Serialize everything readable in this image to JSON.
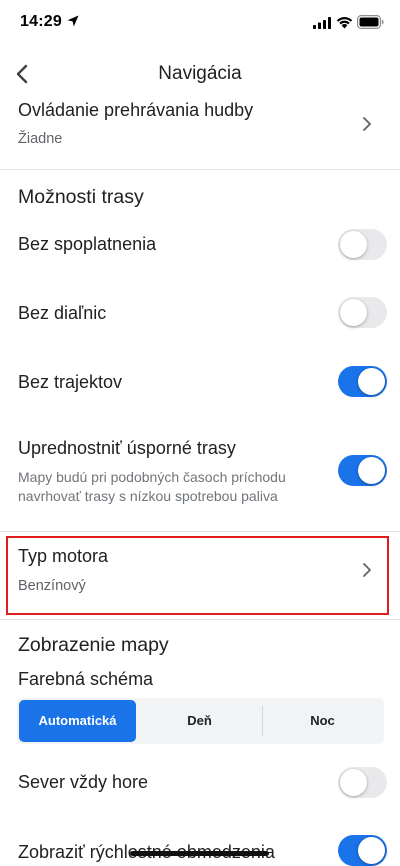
{
  "status_bar": {
    "time": "14:29"
  },
  "header": {
    "title": "Navigácia"
  },
  "music_control": {
    "title": "Ovládanie prehrávania hudby",
    "value": "Žiadne"
  },
  "route_options": {
    "section_title": "Možnosti trasy",
    "avoid_tolls": {
      "label": "Bez spoplatnenia",
      "checked": false
    },
    "avoid_highways": {
      "label": "Bez diaľnic",
      "checked": false
    },
    "avoid_ferries": {
      "label": "Bez trajektov",
      "checked": true
    },
    "eco_routes": {
      "label": "Uprednostniť úsporné trasy",
      "description_line1": "Mapy budú pri podobných časoch príchodu",
      "description_line2": "navrhovať trasy s nízkou spotrebou paliva",
      "checked": true
    }
  },
  "engine_type": {
    "title": "Typ motora",
    "value": "Benzínový"
  },
  "map_display": {
    "section_title": "Zobrazenie mapy",
    "color_scheme_label": "Farebná schéma",
    "color_scheme_options": [
      "Automatická",
      "Deň",
      "Noc"
    ],
    "color_scheme_selected": "Automatická",
    "north_up": {
      "label": "Sever vždy hore",
      "checked": false
    },
    "speed_limits": {
      "label": "Zobraziť rýchlostné obmedzenia",
      "checked": true
    }
  },
  "colors": {
    "accent": "#1a73e8",
    "highlight": "#e21b1b",
    "toggle_off": "#e9e9eb"
  }
}
